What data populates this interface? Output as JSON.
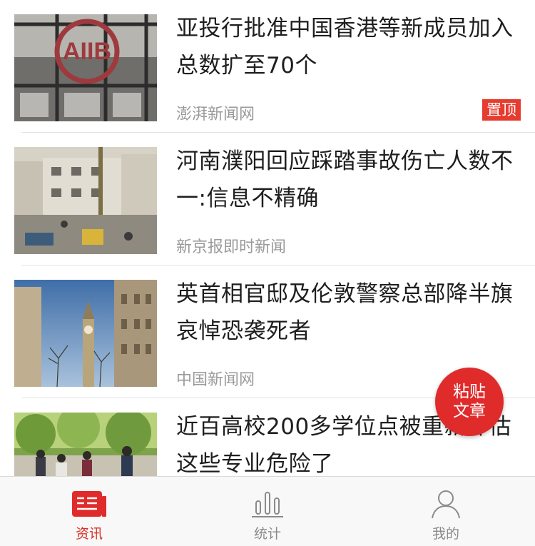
{
  "feed": {
    "items": [
      {
        "title": "亚投行批准中国香港等新成员加入 总数扩至70个",
        "source": "澎湃新闻网",
        "badge": "置顶",
        "thumb_text": "AIIB"
      },
      {
        "title": "河南濮阳回应踩踏事故伤亡人数不一:信息不精确",
        "source": "新京报即时新闻"
      },
      {
        "title": "英首相官邸及伦敦警察总部降半旗 哀悼恐袭死者",
        "source": "中国新闻网"
      },
      {
        "title": "近百高校200多学位点被重新评估 这些专业危险了",
        "source": ""
      }
    ]
  },
  "fab": {
    "line1": "粘贴",
    "line2": "文章"
  },
  "tabbar": {
    "tabs": [
      {
        "label": "资讯",
        "icon": "news-icon",
        "active": true
      },
      {
        "label": "统计",
        "icon": "stats-icon",
        "active": false
      },
      {
        "label": "我的",
        "icon": "user-icon",
        "active": false
      }
    ]
  },
  "colors": {
    "accent": "#e02b2b",
    "source_text": "#9a9a9a",
    "tab_inactive": "#8a8a8a"
  }
}
